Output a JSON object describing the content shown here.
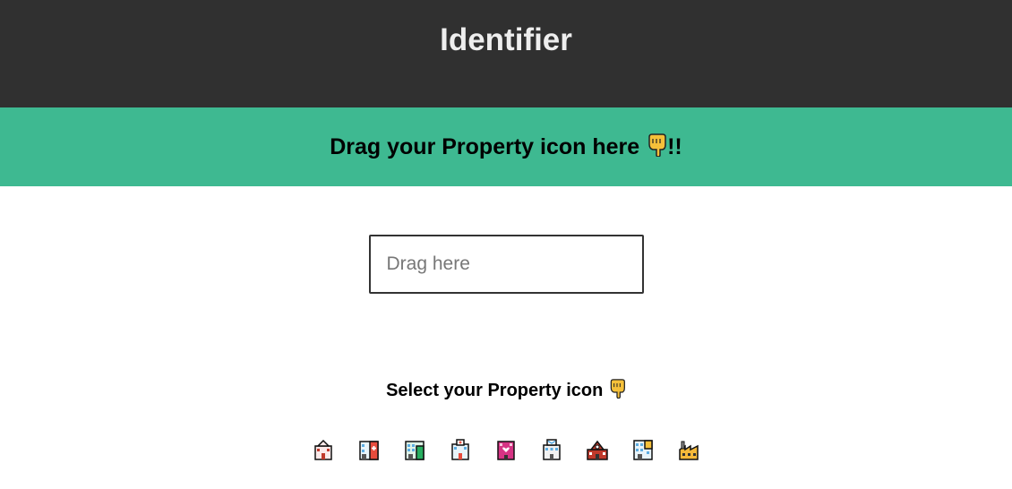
{
  "header": {
    "title": "Identifier"
  },
  "banner": {
    "text": "Drag your Property icon here",
    "suffix": "!!",
    "icon": "backhand-index-pointing-down-icon"
  },
  "drop_field": {
    "placeholder": "Drag here",
    "value": ""
  },
  "selector": {
    "title": "Select your Property icon",
    "title_icon": "backhand-index-pointing-down-icon",
    "icons": [
      "house-building-icon",
      "hospital-icon",
      "office-building-icon",
      "clinic-building-icon",
      "love-hotel-icon",
      "post-office-icon",
      "school-icon",
      "apartment-building-icon",
      "factory-icon"
    ]
  },
  "colors": {
    "header_bg": "#303030",
    "banner_bg": "#3eb991",
    "title_text": "#eeeeee",
    "hand": "#f5c03a"
  }
}
